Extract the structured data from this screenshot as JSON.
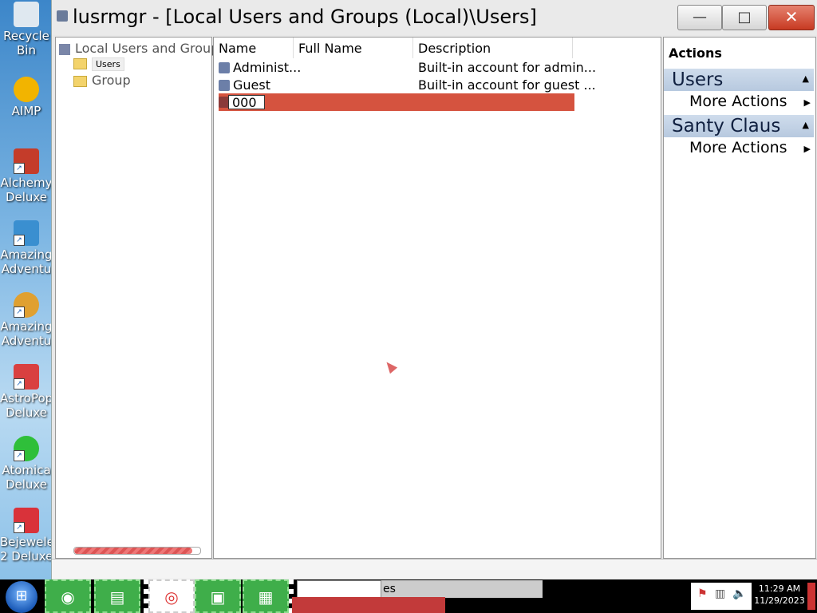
{
  "desktop": {
    "icons": [
      {
        "label1": "Recycle",
        "label2": "Bin",
        "icon": "recycle-bin-icon",
        "color": "#dfe8f0"
      },
      {
        "label1": "AIMP",
        "label2": "",
        "icon": "aimp-icon",
        "color": "#f2b400"
      },
      {
        "label1": "Alchemy",
        "label2": "Deluxe",
        "icon": "alchemy-icon",
        "color": "#c43c2a"
      },
      {
        "label1": "Amazing",
        "label2": "Adventu",
        "icon": "amazing-adventures-icon",
        "color": "#3a8fd0"
      },
      {
        "label1": "Amazing",
        "label2": "Adventu",
        "icon": "amazing-adventures-2-icon",
        "color": "#e0a030"
      },
      {
        "label1": "AstroPop",
        "label2": "Deluxe",
        "icon": "astropop-icon",
        "color": "#d94040"
      },
      {
        "label1": "Atomica",
        "label2": "Deluxe",
        "icon": "atomica-icon",
        "color": "#2fbf3a"
      },
      {
        "label1": "Bejewele",
        "label2": "2 Deluxe",
        "icon": "bejeweled-icon",
        "color": "#d9323a"
      }
    ]
  },
  "window": {
    "title": "lusrmgr - [Local Users and Groups (Local)\\Users]",
    "min_glyph": "—",
    "max_glyph": "□",
    "close_glyph": "✕"
  },
  "tree": {
    "root": "Local Users and Groups",
    "items": [
      {
        "label": "Users"
      },
      {
        "label": "Group"
      }
    ]
  },
  "list": {
    "columns": [
      "Name",
      "Full Name",
      "Description"
    ],
    "rows": [
      {
        "name": "Administ...",
        "full_name": "",
        "description": "Built-in account for admin..."
      },
      {
        "name": "Guest",
        "full_name": "",
        "description": "Built-in account for guest ..."
      }
    ],
    "edit_value": "000"
  },
  "actions": {
    "header": "Actions",
    "sections": [
      {
        "title": "Users",
        "item": "More Actions"
      },
      {
        "title": "Santy Claus",
        "item": "More Actions"
      }
    ]
  },
  "taskbar": {
    "start_glyph": "⊞",
    "task_label": "es",
    "time": "11:29 AM",
    "date": "11/29/2023",
    "apps": [
      {
        "icon": "firefox-icon",
        "glyph": "◉"
      },
      {
        "icon": "file-explorer-icon",
        "glyph": "▤"
      },
      {
        "icon": "chrome-icon",
        "glyph": "◎"
      },
      {
        "icon": "control-panel-icon",
        "glyph": "▣"
      },
      {
        "icon": "toolbox-icon",
        "glyph": "▦"
      }
    ],
    "tray": [
      {
        "icon": "action-center-flag-icon",
        "glyph": "⚑"
      },
      {
        "icon": "network-icon",
        "glyph": "▥"
      },
      {
        "icon": "volume-icon",
        "glyph": "🔈"
      }
    ]
  },
  "colors": {
    "edit_row": "#d5533f",
    "taskbar_app": "#3fae4a",
    "action_section": "#c3d3e6"
  }
}
